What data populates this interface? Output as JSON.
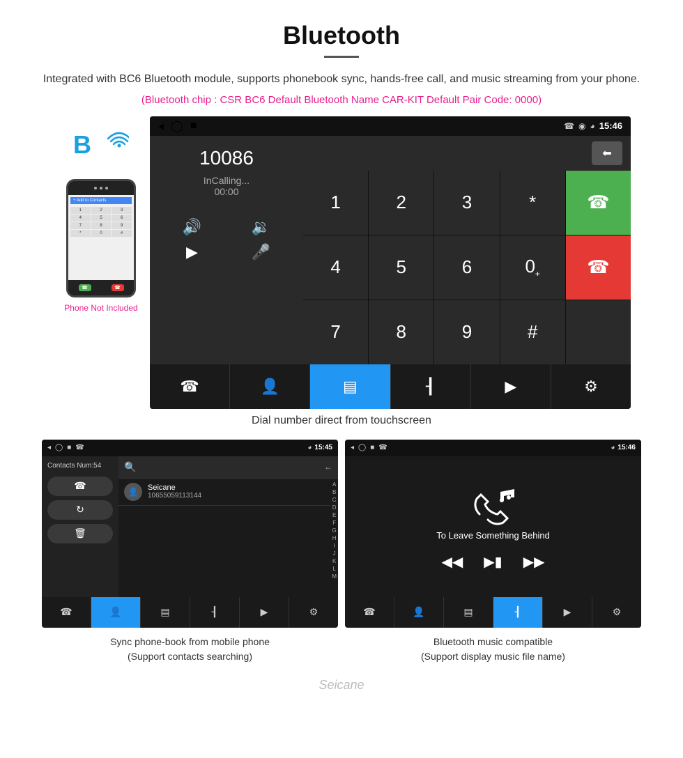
{
  "header": {
    "title": "Bluetooth",
    "description": "Integrated with BC6 Bluetooth module, supports phonebook sync, hands-free call, and music streaming from your phone.",
    "specs": "(Bluetooth chip : CSR BC6    Default Bluetooth Name CAR-KIT    Default Pair Code: 0000)"
  },
  "dial_screen": {
    "status_bar": {
      "time": "15:46"
    },
    "number": "10086",
    "calling_status": "InCalling...",
    "calling_time": "00:00",
    "keypad": [
      "1",
      "2",
      "3",
      "*",
      "4",
      "5",
      "6",
      "0+",
      "7",
      "8",
      "9",
      "#"
    ],
    "caption": "Dial number direct from touchscreen"
  },
  "phone_not_included": "Phone Not Included",
  "phonebook_screen": {
    "status_bar": {
      "time": "15:45"
    },
    "contacts_num": "Contacts Num:54",
    "contact_name": "Seicane",
    "contact_number": "10655059113144",
    "alpha_list": [
      "A",
      "B",
      "C",
      "D",
      "E",
      "F",
      "G",
      "H",
      "I",
      "J",
      "K",
      "L",
      "M"
    ],
    "caption_line1": "Sync phone-book from mobile phone",
    "caption_line2": "(Support contacts searching)"
  },
  "music_screen": {
    "status_bar": {
      "time": "15:46"
    },
    "song_title": "To Leave Something Behind",
    "caption_line1": "Bluetooth music compatible",
    "caption_line2": "(Support display music file name)"
  },
  "watermark": "Seicane"
}
